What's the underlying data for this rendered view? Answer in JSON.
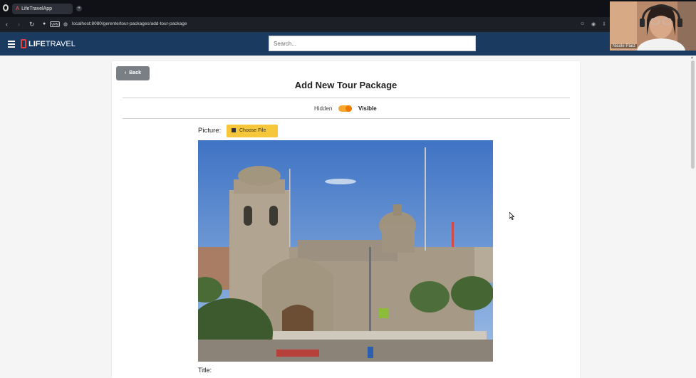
{
  "browser": {
    "tab_title": "LifeTravelApp",
    "tab_favicon": "A",
    "new_tab": "+",
    "vpn_label": "VPN",
    "url": "localhost:8080/gerente/tour-packages/add-tour-package"
  },
  "app": {
    "brand_life": "LIFE",
    "brand_travel": "TRAVEL",
    "search_placeholder": "Search..."
  },
  "page": {
    "back_label": "Back",
    "title": "Add New Tour Package",
    "visibility": {
      "hidden_label": "Hidden",
      "visible_label": "Visible",
      "state": "visible"
    },
    "picture_label": "Picture:",
    "choose_file_label": "Choose File",
    "title_field_label": "Title:"
  },
  "webcam": {
    "participant_name": "Nicole Páez"
  },
  "icons": [
    "menu-icon",
    "choose-file-icon",
    "back-chevron-icon",
    "reload-icon",
    "lock-icon"
  ],
  "colors": {
    "appbar": "#1a3b5f",
    "accent_yellow": "#f7c73b",
    "toggle_orange": "#f07a00",
    "brand_red": "#e8403a"
  }
}
